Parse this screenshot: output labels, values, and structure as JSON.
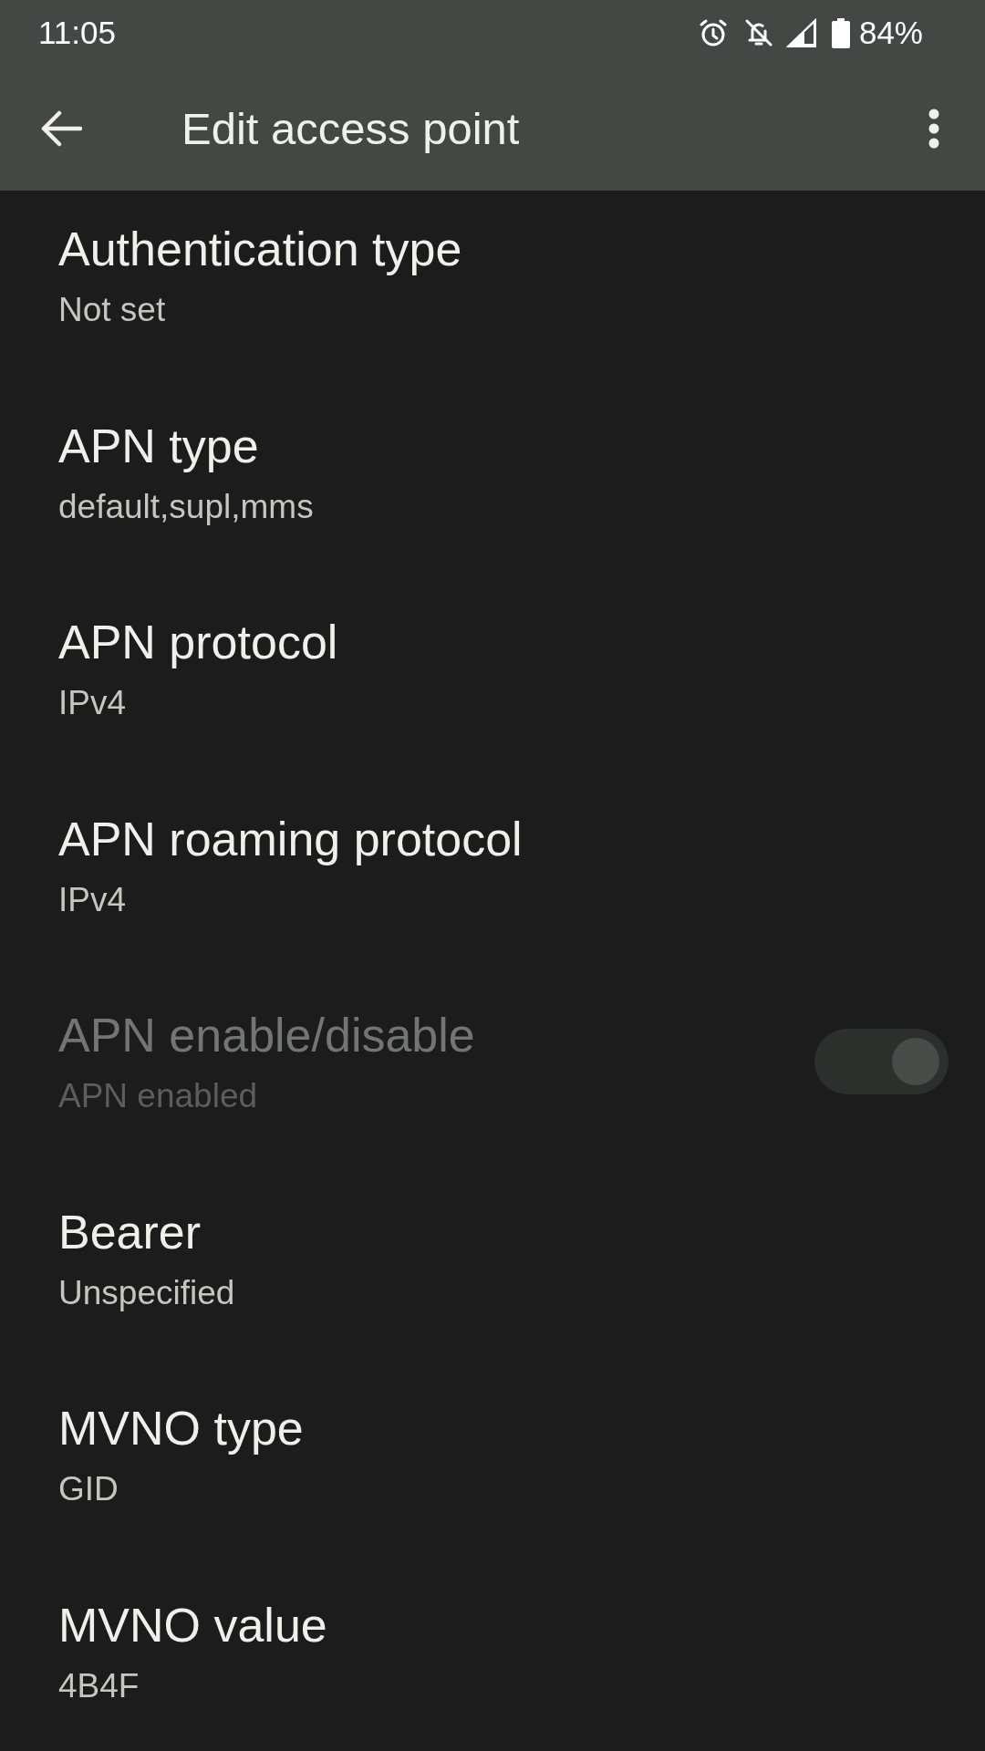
{
  "status_bar": {
    "time": "11:05",
    "battery": "84%"
  },
  "toolbar": {
    "title": "Edit access point"
  },
  "preferences": [
    {
      "kind": "text",
      "title": "Authentication type",
      "summary": "Not set",
      "disabled": false
    },
    {
      "kind": "text",
      "title": "APN type",
      "summary": "default,supl,mms",
      "disabled": false
    },
    {
      "kind": "text",
      "title": "APN protocol",
      "summary": "IPv4",
      "disabled": false
    },
    {
      "kind": "text",
      "title": "APN roaming protocol",
      "summary": "IPv4",
      "disabled": false
    },
    {
      "kind": "switch",
      "title": "APN enable/disable",
      "summary": "APN enabled",
      "disabled": true,
      "on": true
    },
    {
      "kind": "text",
      "title": "Bearer",
      "summary": "Unspecified",
      "disabled": false
    },
    {
      "kind": "text",
      "title": "MVNO type",
      "summary": "GID",
      "disabled": false
    },
    {
      "kind": "text",
      "title": "MVNO value",
      "summary": "4B4F",
      "disabled": false
    }
  ]
}
